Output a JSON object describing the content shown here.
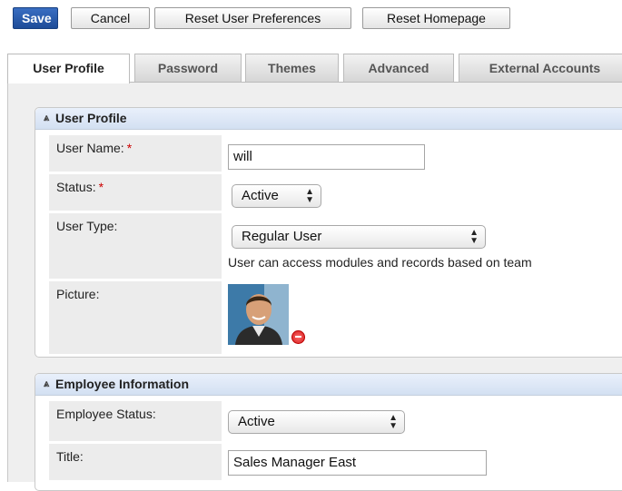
{
  "toolbar": {
    "save": "Save",
    "cancel": "Cancel",
    "reset_prefs": "Reset User Preferences",
    "reset_home": "Reset Homepage"
  },
  "tabs": [
    {
      "label": "User Profile",
      "active": true
    },
    {
      "label": "Password"
    },
    {
      "label": "Themes"
    },
    {
      "label": "Advanced"
    },
    {
      "label": "External Accounts"
    }
  ],
  "user_profile": {
    "title": "User Profile",
    "user_name": {
      "label": "User Name:",
      "required": "*",
      "value": "will"
    },
    "status": {
      "label": "Status:",
      "required": "*",
      "value": "Active"
    },
    "user_type": {
      "label": "User Type:",
      "value": "Regular User",
      "helper": "User can access modules and records based on team"
    },
    "picture": {
      "label": "Picture:"
    }
  },
  "employee_info": {
    "title": "Employee Information",
    "employee_status": {
      "label": "Employee Status:",
      "value": "Active"
    },
    "title_field": {
      "label": "Title:",
      "value": "Sales Manager East"
    }
  },
  "colors": {
    "save_button": "#2a5fb0",
    "panel_header": "#dbe6f5",
    "required": "#cc0000",
    "content_bg": "#efefef"
  },
  "icons": {
    "collapse": "chevron-double-up-icon",
    "select_arrows": "select-arrows-icon",
    "remove_picture": "remove-icon"
  }
}
